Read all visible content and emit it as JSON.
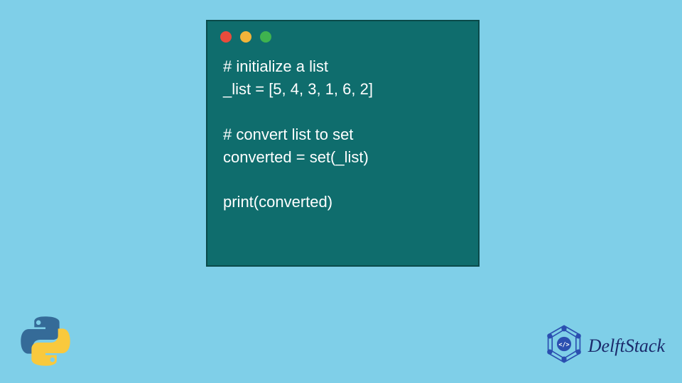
{
  "code": {
    "lines": [
      "# initialize a list",
      "_list = [5, 4, 3, 1, 6, 2]",
      "",
      "# convert list to set",
      "converted = set(_list)",
      "",
      "print(converted)"
    ]
  },
  "brand": {
    "name": "DelftStack"
  },
  "window": {
    "dots": [
      "red",
      "yellow",
      "green"
    ]
  }
}
